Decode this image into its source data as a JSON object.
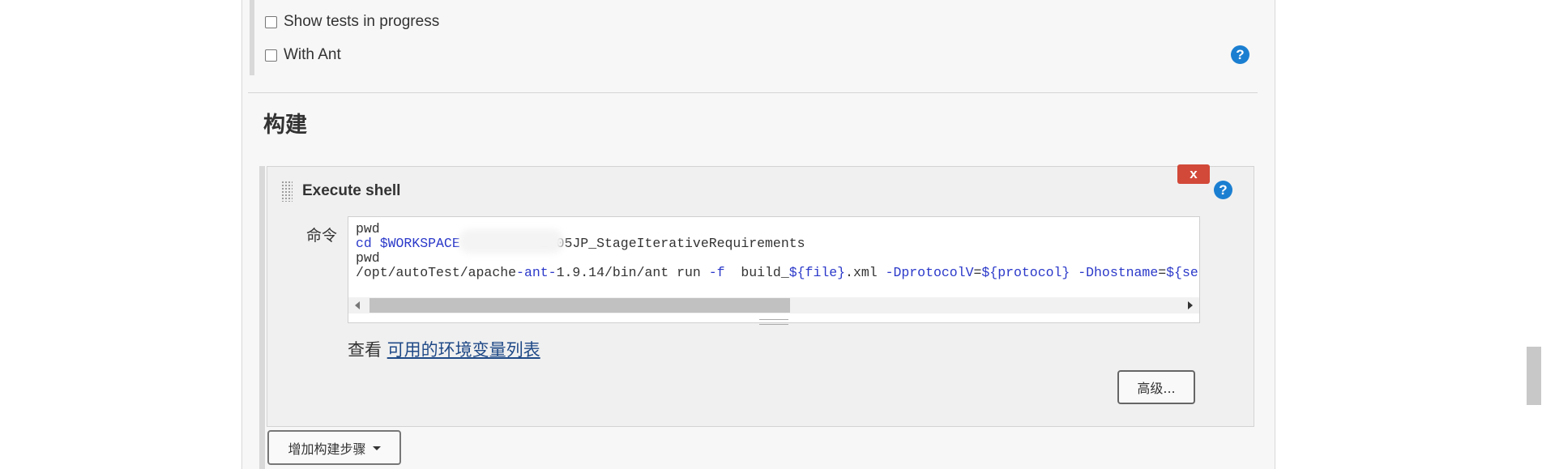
{
  "options": {
    "show_tests_label": "Show tests in progress",
    "with_ant_label": "With Ant"
  },
  "help_glyph": "?",
  "build": {
    "section_title": "构建",
    "step": {
      "title": "Execute shell",
      "delete_label": "x",
      "command_label": "命令",
      "command_lines": {
        "line1": "pwd",
        "line2_cmd": "cd",
        "line2_var": "$WORKSPACE",
        "line2_rest": "I/05JP_StageIterativeRequirements",
        "line3": "pwd",
        "line4_a": "/opt/autoTest/apache",
        "line4_b": "-ant-",
        "line4_c": "1.9.14/bin/ant run ",
        "line4_d": "-f",
        "line4_e": "  build_",
        "line4_f": "${file}",
        "line4_g": ".xml ",
        "line4_h": "-DprotocolV",
        "line4_i": "=",
        "line4_j": "${protocol}",
        "line4_k": " ",
        "line4_l": "-Dhostname",
        "line4_m": "=",
        "line4_n": "${serviceU"
      },
      "env_prefix": "查看 ",
      "env_link": "可用的环境变量列表",
      "advanced_label": "高级..."
    },
    "add_step_label": "增加构建步骤"
  },
  "icons": {
    "help": "help-icon",
    "drag": "drag-handle-icon",
    "caret": "chevron-down-icon"
  },
  "colors": {
    "help_blue": "#1b7fd1",
    "delete_red": "#d24939",
    "link_blue": "#204a87"
  }
}
